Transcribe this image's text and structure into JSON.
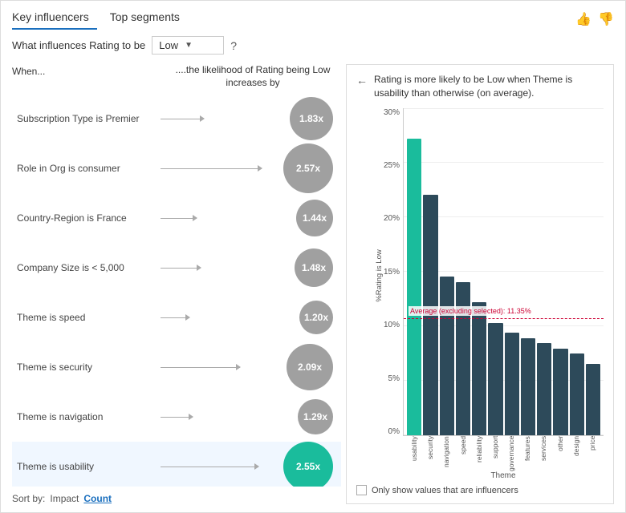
{
  "header": {
    "tab1": "Key influencers",
    "tab2": "Top segments",
    "thumb_up": "👍",
    "thumb_down": "👎"
  },
  "filter": {
    "label": "What influences Rating to be",
    "value": "Low",
    "question": "?"
  },
  "left": {
    "col1_header": "When...",
    "col2_header": "....the likelihood of Rating being Low increases by",
    "influencers": [
      {
        "label": "Subscription Type is Premier",
        "value": "1.83x",
        "size": 54,
        "offset_pct": 30
      },
      {
        "label": "Role in Org is consumer",
        "value": "2.57x",
        "size": 62,
        "offset_pct": 70
      },
      {
        "label": "Country-Region is France",
        "value": "1.44x",
        "size": 46,
        "offset_pct": 25
      },
      {
        "label": "Company Size is < 5,000",
        "value": "1.48x",
        "size": 48,
        "offset_pct": 28
      },
      {
        "label": "Theme is speed",
        "value": "1.20x",
        "size": 42,
        "offset_pct": 20
      },
      {
        "label": "Theme is security",
        "value": "2.09x",
        "size": 58,
        "offset_pct": 55
      },
      {
        "label": "Theme is navigation",
        "value": "1.29x",
        "size": 44,
        "offset_pct": 22
      },
      {
        "label": "Theme is usability",
        "value": "2.55x",
        "size": 62,
        "offset_pct": 68,
        "selected": true
      }
    ]
  },
  "right": {
    "back_arrow": "←",
    "title": "Rating is more likely to be Low when Theme is usability than otherwise (on average).",
    "y_label": "%Rating is Low",
    "x_label": "Theme",
    "average_line_pct": 37.8,
    "average_label": "Average (excluding selected): 11.35%",
    "bars": [
      {
        "label": "usability",
        "value": 29,
        "teal": true
      },
      {
        "label": "security",
        "value": 23.5,
        "teal": false
      },
      {
        "label": "navigation",
        "value": 15.5,
        "teal": false
      },
      {
        "label": "speed",
        "value": 15,
        "teal": false
      },
      {
        "label": "reliability",
        "value": 13,
        "teal": false
      },
      {
        "label": "support",
        "value": 11,
        "teal": false
      },
      {
        "label": "governance",
        "value": 10,
        "teal": false
      },
      {
        "label": "features",
        "value": 9.5,
        "teal": false
      },
      {
        "label": "services",
        "value": 9,
        "teal": false
      },
      {
        "label": "other",
        "value": 8.5,
        "teal": false
      },
      {
        "label": "design",
        "value": 8,
        "teal": false
      },
      {
        "label": "price",
        "value": 7,
        "teal": false
      }
    ],
    "y_ticks": [
      "30%",
      "25%",
      "20%",
      "15%",
      "10%",
      "5%",
      "0%"
    ],
    "checkbox_label": "Only show values that are influencers"
  },
  "sort": {
    "label": "Sort by:",
    "option1": "Impact",
    "option2": "Count"
  }
}
